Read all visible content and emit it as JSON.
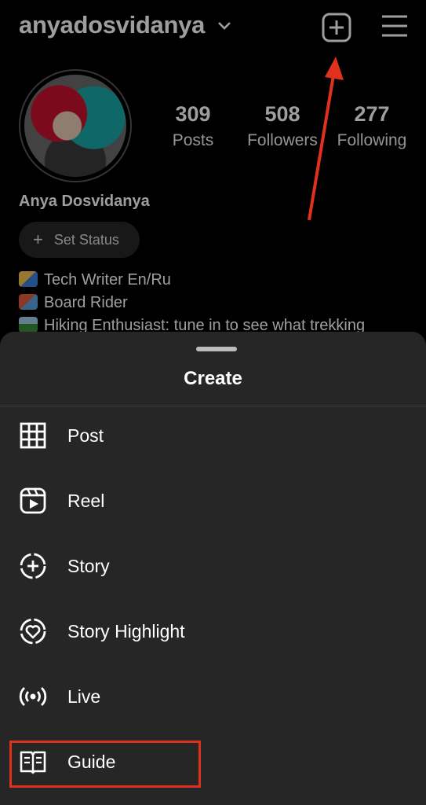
{
  "header": {
    "username": "anyadosvidanya",
    "icons": [
      "chevron-down-icon",
      "add-post-icon",
      "hamburger-menu-icon"
    ]
  },
  "profile": {
    "stats": [
      {
        "value": "309",
        "label": "Posts"
      },
      {
        "value": "508",
        "label": "Followers"
      },
      {
        "value": "277",
        "label": "Following"
      }
    ],
    "display_name": "Anya Dosvidanya",
    "set_status": "Set Status",
    "bio": [
      {
        "text": "Tech Writer En/Ru",
        "icon": "writing-hand-emoji"
      },
      {
        "text": "Board Rider",
        "icon": "snowboarder-emoji"
      },
      {
        "text": "Hiking Enthusiast: tune in to see what trekking",
        "icon": "mountain-emoji"
      }
    ]
  },
  "sheet": {
    "title": "Create",
    "items": [
      {
        "label": "Post",
        "icon": "grid-icon"
      },
      {
        "label": "Reel",
        "icon": "reel-icon"
      },
      {
        "label": "Story",
        "icon": "story-add-icon"
      },
      {
        "label": "Story Highlight",
        "icon": "story-highlight-heart-icon"
      },
      {
        "label": "Live",
        "icon": "live-broadcast-icon"
      },
      {
        "label": "Guide",
        "icon": "guide-book-icon"
      }
    ]
  },
  "colors": {
    "sheet_bg": "#262626",
    "annotation_red": "#e0301e"
  }
}
